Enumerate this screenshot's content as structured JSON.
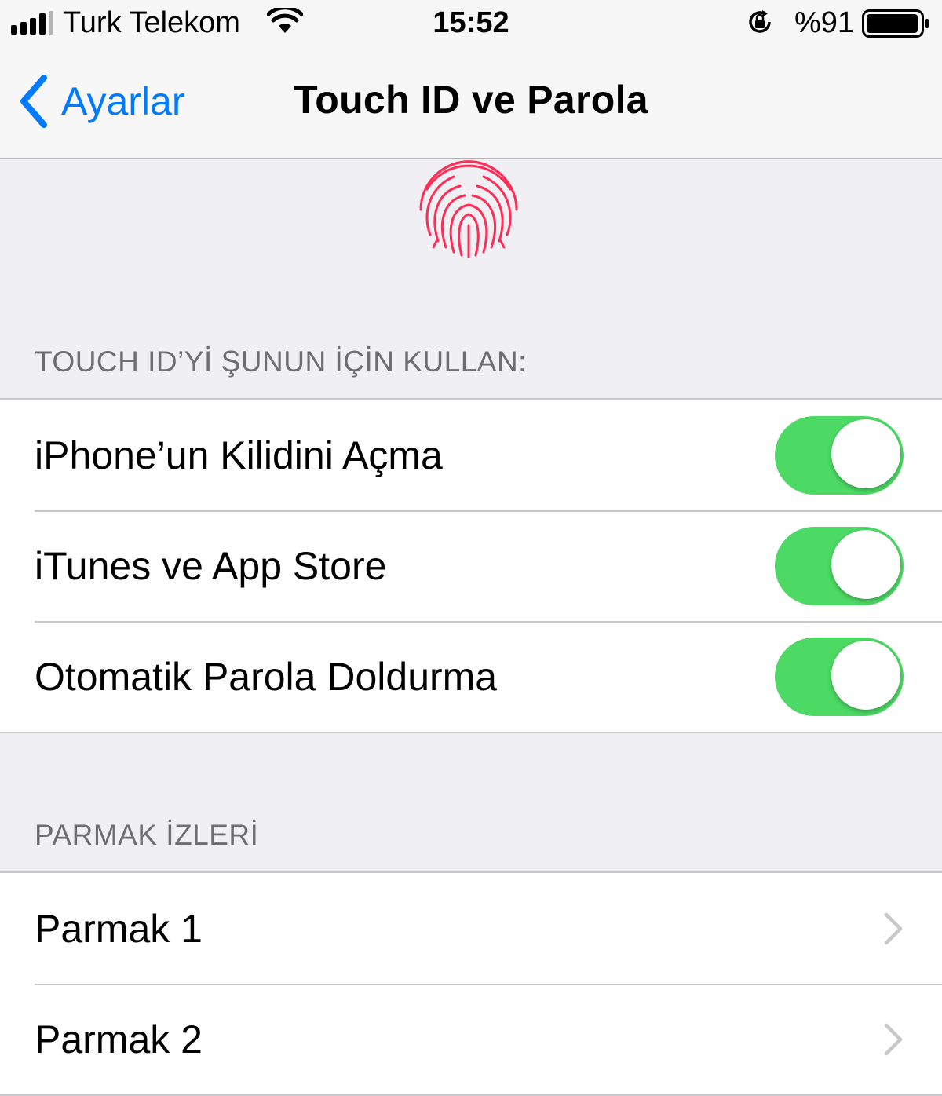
{
  "status_bar": {
    "carrier": "Turk Telekom",
    "time": "15:52",
    "battery_percent": "%91",
    "signal_icon": "signal-bars-icon",
    "wifi_icon": "wifi-icon",
    "lock_icon": "orientation-lock-icon",
    "battery_icon": "battery-icon"
  },
  "nav": {
    "back_label": "Ayarlar",
    "title": "Touch ID ve Parola",
    "back_icon": "chevron-left-icon"
  },
  "hero": {
    "icon": "fingerprint-icon",
    "color": "#ff2d55"
  },
  "touch_id_section": {
    "header": "TOUCH ID’Yİ ŞUNUN İÇİN KULLAN:",
    "items": [
      {
        "label": "iPhone’un Kilidini Açma",
        "enabled": true
      },
      {
        "label": "iTunes ve App Store",
        "enabled": true
      },
      {
        "label": "Otomatik Parola Doldurma",
        "enabled": true
      }
    ]
  },
  "fingerprints_section": {
    "header": "PARMAK İZLERİ",
    "items": [
      {
        "label": "Parmak 1"
      },
      {
        "label": "Parmak 2"
      }
    ]
  },
  "colors": {
    "accent": "#007aff",
    "toggle_on": "#4cd964",
    "background": "#efeff4",
    "section_header": "#6d6d72"
  }
}
